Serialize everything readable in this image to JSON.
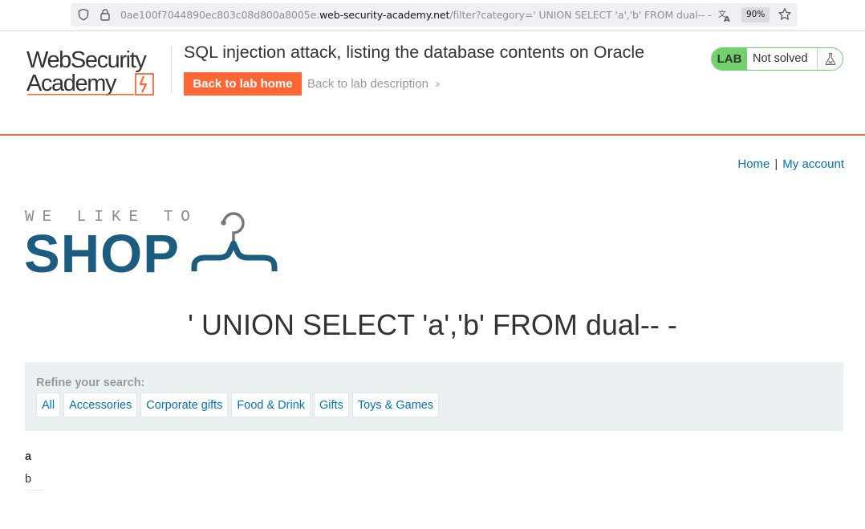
{
  "browser": {
    "url_prefix": "0ae100f7044890ec803c08d800a8005e.",
    "url_host": "web-security-academy.net",
    "url_path": "/filter?category=' UNION SELECT 'a','b' FROM dual-- -",
    "zoom": "90%"
  },
  "academy": {
    "logo_text_line1": "WebSecurity",
    "logo_text_line2": "Academy",
    "lab_title": "SQL injection attack, listing the database contents on Oracle",
    "back_home_label": "Back to lab home",
    "back_description_label": "Back to lab description",
    "lab_badge": "LAB",
    "lab_status": "Not solved"
  },
  "nav": {
    "home": "Home",
    "separator": "|",
    "my_account": "My account"
  },
  "shop_logo": {
    "tagline": "WE LIKE TO",
    "name": "SHOP"
  },
  "heading": "' UNION SELECT 'a','b' FROM dual-- -",
  "filter": {
    "label": "Refine your search:",
    "categories": [
      "All",
      "Accessories",
      "Corporate gifts",
      "Food & Drink",
      "Gifts",
      "Toys & Games"
    ]
  },
  "results": {
    "header": "a",
    "cell": "b"
  },
  "colors": {
    "accent": "#ff6633",
    "link": "#0071bc",
    "lab_green": "#70d16d",
    "shop_blue": "#1c5c80"
  }
}
